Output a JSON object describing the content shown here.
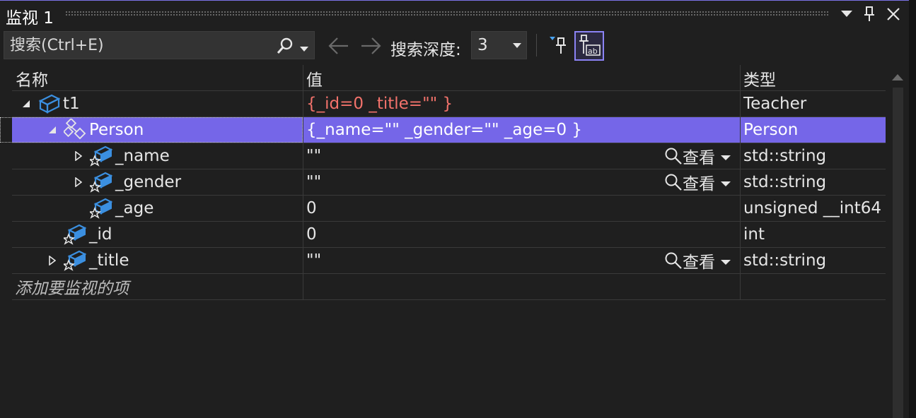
{
  "window": {
    "title": "监视 1"
  },
  "toolbar": {
    "search_placeholder": "搜索(Ctrl+E)",
    "depth_label": "搜索深度:",
    "depth_value": "3"
  },
  "columns": {
    "name": "名称",
    "value": "值",
    "type": "类型"
  },
  "rows": [
    {
      "name": "t1",
      "value": "{_id=0 _title=\"\" }",
      "type": "Teacher",
      "depth": 0,
      "expander": "expanded",
      "icon": "class-object-icon",
      "value_changed": true,
      "viewer": false,
      "selected": false
    },
    {
      "name": "Person",
      "value": "{_name=\"\" _gender=\"\" _age=0 }",
      "type": "Person",
      "depth": 1,
      "expander": "expanded",
      "icon": "base-class-icon",
      "value_changed": false,
      "viewer": false,
      "selected": true
    },
    {
      "name": "_name",
      "value": "\"\"",
      "type": "std::string",
      "depth": 2,
      "expander": "collapsed",
      "icon": "field-icon",
      "value_changed": false,
      "viewer": true,
      "selected": false
    },
    {
      "name": "_gender",
      "value": "\"\"",
      "type": "std::string",
      "depth": 2,
      "expander": "collapsed",
      "icon": "field-icon",
      "value_changed": false,
      "viewer": true,
      "selected": false
    },
    {
      "name": "_age",
      "value": "0",
      "type": "unsigned __int64",
      "depth": 2,
      "expander": "none",
      "icon": "field-icon",
      "value_changed": false,
      "viewer": false,
      "selected": false
    },
    {
      "name": "_id",
      "value": "0",
      "type": "int",
      "depth": 1,
      "expander": "none",
      "icon": "field-icon",
      "value_changed": false,
      "viewer": false,
      "selected": false
    },
    {
      "name": "_title",
      "value": "\"\"",
      "type": "std::string",
      "depth": 1,
      "expander": "collapsed",
      "icon": "field-icon",
      "value_changed": false,
      "viewer": true,
      "selected": false
    }
  ],
  "viewer_label": "查看",
  "add_watch_placeholder": "添加要监视的项",
  "colors": {
    "accent": "#7566e8",
    "changed_value": "#f2726b",
    "icon_blue": "#3b8fe0"
  }
}
